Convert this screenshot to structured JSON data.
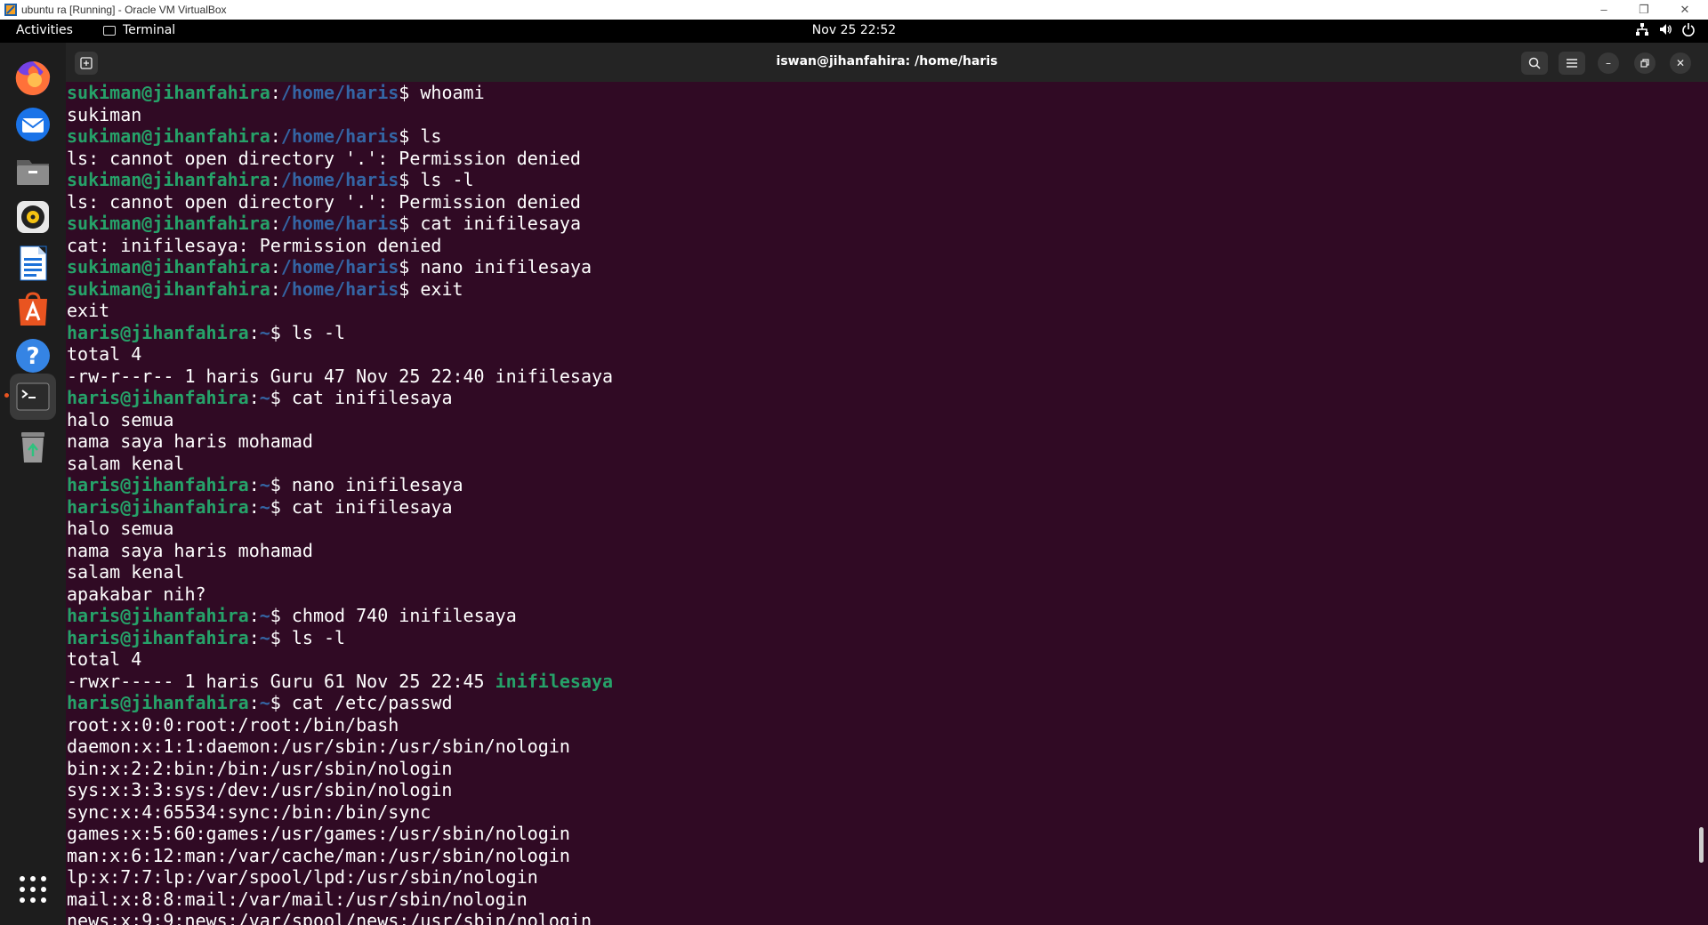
{
  "host_window": {
    "title": "ubuntu ra [Running] - Oracle VM VirtualBox"
  },
  "top_bar": {
    "activities": "Activities",
    "app_name": "Terminal",
    "clock": "Nov 25  22:52"
  },
  "terminal": {
    "title": "iswan@jihanfahira: /home/haris",
    "lines": [
      {
        "user": "sukiman@jihanfahira",
        "sep": ":",
        "path": "/home/haris",
        "cmd": "$ whoami"
      },
      {
        "out": "sukiman"
      },
      {
        "user": "sukiman@jihanfahira",
        "sep": ":",
        "path": "/home/haris",
        "cmd": "$ ls"
      },
      {
        "out": "ls: cannot open directory '.': Permission denied"
      },
      {
        "user": "sukiman@jihanfahira",
        "sep": ":",
        "path": "/home/haris",
        "cmd": "$ ls -l"
      },
      {
        "out": "ls: cannot open directory '.': Permission denied"
      },
      {
        "user": "sukiman@jihanfahira",
        "sep": ":",
        "path": "/home/haris",
        "cmd": "$ cat inifilesaya"
      },
      {
        "out": "cat: inifilesaya: Permission denied"
      },
      {
        "user": "sukiman@jihanfahira",
        "sep": ":",
        "path": "/home/haris",
        "cmd": "$ nano inifilesaya"
      },
      {
        "user": "sukiman@jihanfahira",
        "sep": ":",
        "path": "/home/haris",
        "cmd": "$ exit"
      },
      {
        "out": "exit"
      },
      {
        "user": "haris@jihanfahira",
        "sep": ":",
        "path": "~",
        "cmd": "$ ls -l"
      },
      {
        "out": "total 4"
      },
      {
        "out": "-rw-r--r-- 1 haris Guru 47 Nov 25 22:40 inifilesaya"
      },
      {
        "user": "haris@jihanfahira",
        "sep": ":",
        "path": "~",
        "cmd": "$ cat inifilesaya"
      },
      {
        "out": "halo semua"
      },
      {
        "out": "nama saya haris mohamad"
      },
      {
        "out": "salam kenal"
      },
      {
        "user": "haris@jihanfahira",
        "sep": ":",
        "path": "~",
        "cmd": "$ nano inifilesaya"
      },
      {
        "user": "haris@jihanfahira",
        "sep": ":",
        "path": "~",
        "cmd": "$ cat inifilesaya"
      },
      {
        "out": "halo semua"
      },
      {
        "out": "nama saya haris mohamad"
      },
      {
        "out": "salam kenal"
      },
      {
        "out": "apakabar nih?"
      },
      {
        "user": "haris@jihanfahira",
        "sep": ":",
        "path": "~",
        "cmd": "$ chmod 740 inifilesaya"
      },
      {
        "user": "haris@jihanfahira",
        "sep": ":",
        "path": "~",
        "cmd": "$ ls -l"
      },
      {
        "out": "total 4"
      },
      {
        "out": "-rwxr----- 1 haris Guru 61 Nov 25 22:45 ",
        "hl": "inifilesaya"
      },
      {
        "user": "haris@jihanfahira",
        "sep": ":",
        "path": "~",
        "cmd": "$ cat /etc/passwd"
      },
      {
        "out": "root:x:0:0:root:/root:/bin/bash"
      },
      {
        "out": "daemon:x:1:1:daemon:/usr/sbin:/usr/sbin/nologin"
      },
      {
        "out": "bin:x:2:2:bin:/bin:/usr/sbin/nologin"
      },
      {
        "out": "sys:x:3:3:sys:/dev:/usr/sbin/nologin"
      },
      {
        "out": "sync:x:4:65534:sync:/bin:/bin/sync"
      },
      {
        "out": "games:x:5:60:games:/usr/games:/usr/sbin/nologin"
      },
      {
        "out": "man:x:6:12:man:/var/cache/man:/usr/sbin/nologin"
      },
      {
        "out": "lp:x:7:7:lp:/var/spool/lpd:/usr/sbin/nologin"
      },
      {
        "out": "mail:x:8:8:mail:/var/mail:/usr/sbin/nologin"
      },
      {
        "out": "news:x:9:9:news:/var/spool/news:/usr/sbin/nologin"
      }
    ]
  },
  "dock": {
    "items": [
      {
        "name": "firefox-icon"
      },
      {
        "name": "thunderbird-icon"
      },
      {
        "name": "files-icon"
      },
      {
        "name": "rhythmbox-icon"
      },
      {
        "name": "libreoffice-writer-icon"
      },
      {
        "name": "app-center-icon"
      },
      {
        "name": "help-icon"
      },
      {
        "name": "terminal-icon"
      },
      {
        "name": "trash-icon"
      }
    ]
  },
  "colors": {
    "terminal_bg": "#300a24",
    "prompt_user": "#26a269",
    "prompt_path": "#3465a4",
    "header_bg": "#242424",
    "accent": "#e95420"
  }
}
